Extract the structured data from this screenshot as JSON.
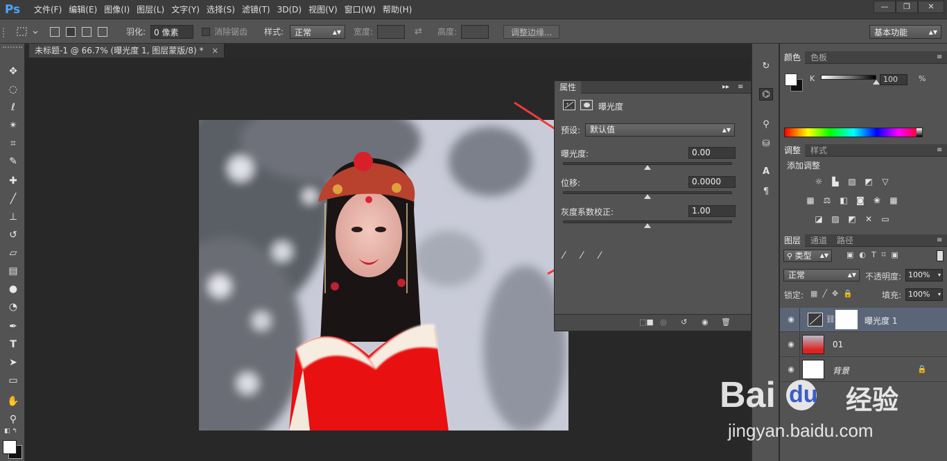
{
  "app": {
    "logo": "Ps"
  },
  "menu": [
    "文件(F)",
    "编辑(E)",
    "图像(I)",
    "图层(L)",
    "文字(Y)",
    "选择(S)",
    "滤镜(T)",
    "3D(D)",
    "视图(V)",
    "窗口(W)",
    "帮助(H)"
  ],
  "window_controls": {
    "minimize": "—",
    "restore": "❐",
    "close": "✕"
  },
  "options": {
    "feather_label": "羽化:",
    "feather_value": "0 像素",
    "antialias_label": "消除锯齿",
    "style_label": "样式:",
    "style_value": "正常",
    "width_label": "宽度:",
    "height_label": "高度:",
    "refine_button": "调整边缘...",
    "workspace": "基本功能"
  },
  "document_tab": {
    "title": "未标题-1 @ 66.7% (曝光度 1, 图层蒙版/8) *",
    "close": "×"
  },
  "properties": {
    "tab": "属性",
    "header_title": "曝光度",
    "preset_label": "预设:",
    "preset_value": "默认值",
    "exposure_label": "曝光度:",
    "exposure_value": "0.00",
    "exposure_pos": 0.5,
    "offset_label": "位移:",
    "offset_value": "0.0000",
    "offset_pos": 0.5,
    "gamma_label": "灰度系数校正:",
    "gamma_value": "1.00",
    "gamma_pos": 0.5
  },
  "color_panel": {
    "tab_active": "颜色",
    "tab_inactive": "色板",
    "channel": "K",
    "value": "100",
    "unit": "%",
    "slider_pos": 1.0
  },
  "adjust_panel": {
    "tab_active": "调整",
    "tab_inactive": "样式",
    "title": "添加调整"
  },
  "layers_panel": {
    "tabs": [
      "图层",
      "通道",
      "路径"
    ],
    "filter_value": "类型",
    "blend_mode": "正常",
    "opacity_label": "不透明度:",
    "opacity_value": "100%",
    "lock_label": "锁定:",
    "fill_label": "填充:",
    "fill_value": "100%",
    "layers": [
      {
        "name": "曝光度 1",
        "selected": true
      },
      {
        "name": "01",
        "selected": false
      },
      {
        "name": "背景",
        "selected": false
      }
    ]
  },
  "watermark": {
    "brand": "Bai",
    "brand_cn": "经验",
    "url": "jingyan.baidu.com"
  },
  "colors": {
    "accent_blue": "#4ca6ff",
    "arrow_red": "#f03a3a",
    "selected_layer": "#5a6678"
  }
}
